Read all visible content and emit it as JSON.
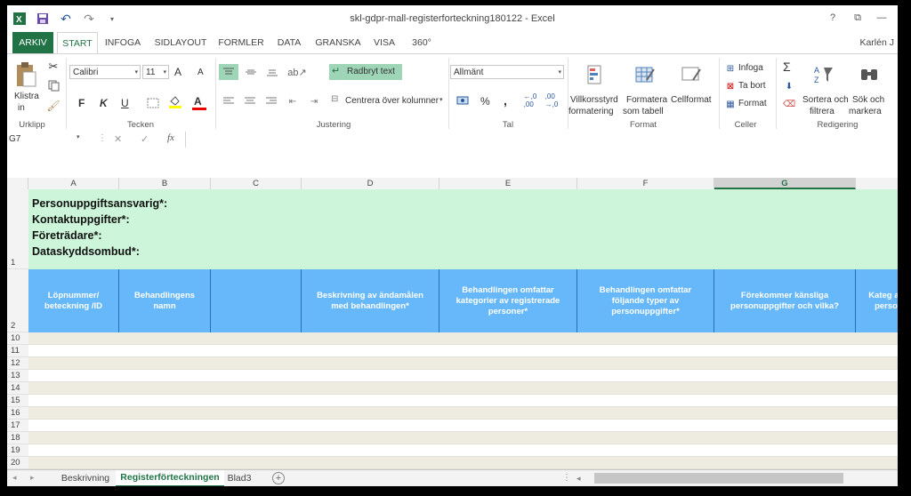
{
  "window": {
    "title": "skl-gdpr-mall-registerforteckning180122 - Excel",
    "help": "?",
    "restore": "⧉",
    "minimize": "—",
    "user": "Karlén J"
  },
  "tabs": [
    "ARKIV",
    "START",
    "INFOGA",
    "SIDLAYOUT",
    "FORMLER",
    "DATA",
    "GRANSKA",
    "VISA",
    "360°"
  ],
  "ribbon": {
    "clipboard": {
      "paste_label": "Klistra",
      "paste_label2": "in",
      "group": "Urklipp"
    },
    "font": {
      "name": "Calibri",
      "size": "11",
      "bold": "F",
      "italic": "K",
      "underline": "U",
      "grow": "A",
      "shrink": "A",
      "font_color": "A",
      "group": "Tecken"
    },
    "alignment": {
      "wrap": "Radbryt text",
      "merge": "Centrera över kolumner",
      "group": "Justering"
    },
    "number": {
      "format": "Allmänt",
      "percent": "%",
      "comma": ",",
      "group": "Tal"
    },
    "styles": {
      "cond_format": "Villkorsstyrd",
      "cond_format2": "formatering",
      "format_table": "Formatera",
      "format_table2": "som tabell",
      "cell_style": "Cellformat",
      "group": "Format"
    },
    "cells": {
      "insert": "Infoga",
      "delete": "Ta bort",
      "format": "Format",
      "group": "Celler"
    },
    "editing": {
      "sigma": "Σ",
      "sort": "Sortera och",
      "sort2": "filtrera",
      "find": "Sök och",
      "find2": "markera",
      "group": "Redigering"
    }
  },
  "formula_bar": {
    "name_box": "G7",
    "fx": "fx",
    "cancel": "✕",
    "enter": "✓"
  },
  "columns": [
    "A",
    "B",
    "C",
    "D",
    "E",
    "F",
    "G"
  ],
  "row1_lines": [
    "Personuppgiftsansvarig*:",
    "Kontaktuppgifter*:",
    "Företrädare*:",
    "Dataskyddsombud*:"
  ],
  "header_cells": [
    "Löpnummer/ beteckning /ID",
    "Behandlingens namn",
    "",
    "Beskrivning av ändamålen med behandlingen*",
    "Behandlingen omfattar kategorier av registrerade personer*",
    "Behandlingen omfattar följande typer av personuppgifter*",
    "Förekommer känsliga personuppgifter och vilka?",
    "Kateg av perso"
  ],
  "row_numbers": [
    "1",
    "2",
    "10",
    "11",
    "12",
    "13",
    "14",
    "15",
    "16",
    "17",
    "18",
    "19",
    "20"
  ],
  "sheets": [
    "Beskrivning",
    "Registerförteckningen",
    "Blad3"
  ],
  "colors": {
    "accent": "#217346",
    "header_blue": "#66b8fa",
    "row1_green": "#ccf5d9",
    "band": "#eeece1"
  }
}
